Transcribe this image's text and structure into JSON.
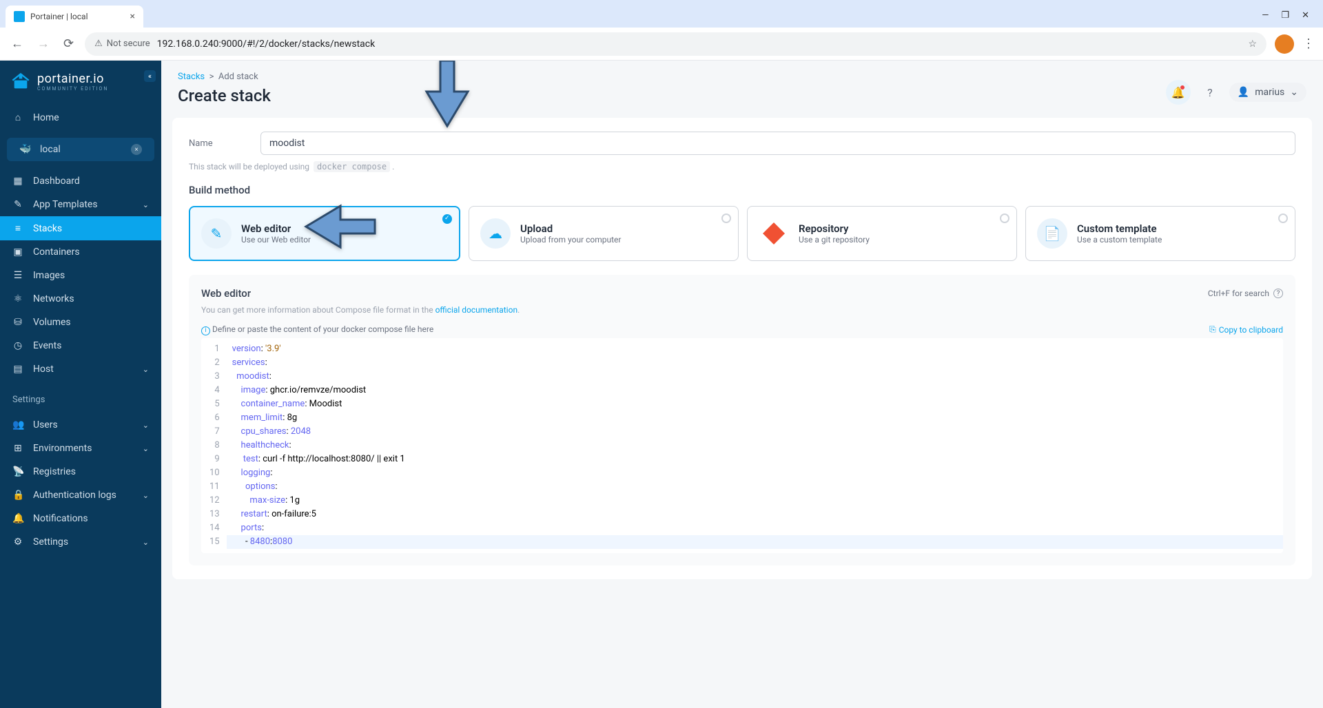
{
  "browser": {
    "tab_title": "Portainer | local",
    "not_secure": "Not secure",
    "url": "192.168.0.240:9000/#!/2/docker/stacks/newstack"
  },
  "sidebar": {
    "logo_main": "portainer.io",
    "logo_sub": "COMMUNITY EDITION",
    "home": "Home",
    "env_name": "local",
    "nav": {
      "dashboard": "Dashboard",
      "app_templates": "App Templates",
      "stacks": "Stacks",
      "containers": "Containers",
      "images": "Images",
      "networks": "Networks",
      "volumes": "Volumes",
      "events": "Events",
      "host": "Host"
    },
    "settings_heading": "Settings",
    "settings": {
      "users": "Users",
      "environments": "Environments",
      "registries": "Registries",
      "auth_logs": "Authentication logs",
      "notifications": "Notifications",
      "settings": "Settings"
    }
  },
  "header": {
    "breadcrumb_stacks": "Stacks",
    "breadcrumb_add": "Add stack",
    "title": "Create stack",
    "user": "marius"
  },
  "form": {
    "name_label": "Name",
    "name_value": "moodist",
    "help_text": "This stack will be deployed using",
    "help_code": "docker compose",
    "build_method_title": "Build method"
  },
  "methods": {
    "web_editor": {
      "title": "Web editor",
      "sub": "Use our Web editor"
    },
    "upload": {
      "title": "Upload",
      "sub": "Upload from your computer"
    },
    "repository": {
      "title": "Repository",
      "sub": "Use a git repository"
    },
    "custom": {
      "title": "Custom template",
      "sub": "Use a custom template"
    }
  },
  "editor": {
    "title": "Web editor",
    "search_hint": "Ctrl+F for search",
    "info_text": "You can get more information about Compose file format in the",
    "info_link": "official documentation",
    "placeholder_hint": "Define or paste the content of your docker compose file here",
    "copy": "Copy to clipboard"
  },
  "code": {
    "l1": "version: '3.9'",
    "l2": "services:",
    "l3": "  moodist:",
    "l4": "    image: ghcr.io/remvze/moodist",
    "l5": "    container_name: Moodist",
    "l6": "    mem_limit: 8g",
    "l7": "    cpu_shares: 2048",
    "l8": "    healthcheck:",
    "l9": "     test: curl -f http://localhost:8080/ || exit 1",
    "l10": "    logging:",
    "l11": "      options:",
    "l12": "        max-size: 1g",
    "l13": "    restart: on-failure:5",
    "l14": "    ports:",
    "l15": "      - 8480:8080"
  }
}
